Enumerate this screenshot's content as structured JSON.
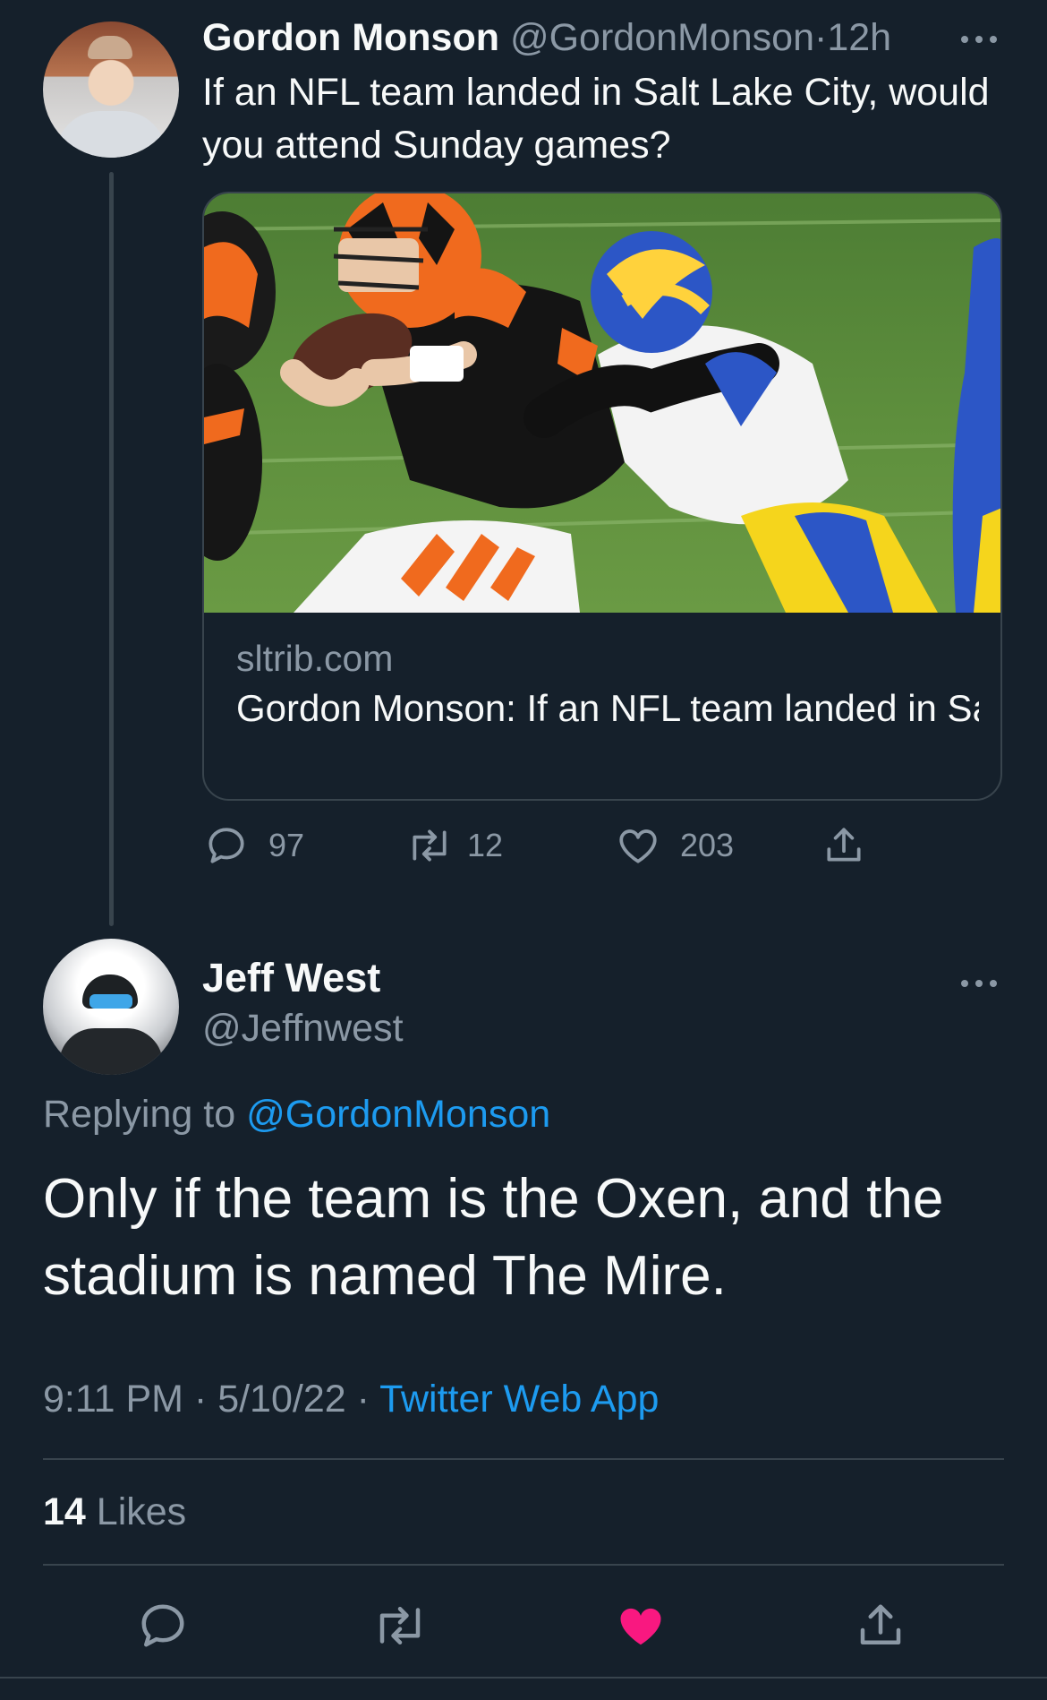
{
  "parent_tweet": {
    "author_name": "Gordon Monson",
    "author_handle": "@GordonMonson",
    "separator": "·",
    "time_ago": "12h",
    "text": "If an NFL team landed in Salt Lake City, would you attend Sunday games?",
    "card": {
      "domain": "sltrib.com",
      "title": "Gordon Monson: If an NFL team landed in Salt Lake City, would you attend Sun..."
    },
    "actions": {
      "replies": "97",
      "retweets": "12",
      "likes": "203"
    }
  },
  "reply_tweet": {
    "author_name": "Jeff West",
    "author_handle": "@Jeffnwest",
    "replying_label": "Replying to",
    "replying_mention": "@GordonMonson",
    "text": "Only if the team is the Oxen, and the stadium is named The Mire.",
    "time": "9:11 PM",
    "date": "5/10/22",
    "separator": "·",
    "source": "Twitter Web App",
    "likes_count": "14",
    "likes_label": "Likes",
    "liked": true
  },
  "colors": {
    "background": "#15202b",
    "text_primary": "#f7f9f9",
    "text_secondary": "#8b98a5",
    "accent_blue": "#1d9bf0",
    "like_pink": "#f91880",
    "border": "#38444d"
  },
  "icons": {
    "reply": "speech-bubble-icon",
    "retweet": "retweet-arrows-icon",
    "like": "heart-icon",
    "share": "share-upload-icon",
    "more": "ellipsis-icon"
  }
}
